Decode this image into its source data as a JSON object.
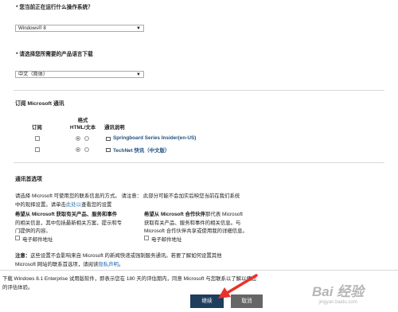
{
  "os_question": {
    "label": "* 您当前正在运行什么操作系统？",
    "value": "Windows® 8"
  },
  "lang_question": {
    "label": "* 请选择您所需要的产品语言下载",
    "value": "中文（简体）"
  },
  "subscribe": {
    "title": "订阅 Microsoft 通讯",
    "col_subscribe": "订阅",
    "col_format_line1": "格式",
    "col_format_line2": "HTML/文本",
    "col_desc": "通讯说明",
    "rows": [
      {
        "name": "Springboard Series Insider(en-US)"
      },
      {
        "name": "TechNet 快讯（中文版）"
      }
    ]
  },
  "prefs": {
    "title": "通讯首选项",
    "intro_line1": "请选择 Microsoft 可使用您的联系信息的方式。 请注意： 此部分可能不会加实后映您当前在我们系统",
    "intro_line2_a": "中的现",
    "intro_line2_b": "择设置。请单击",
    "intro_line2_link": "此处以",
    "intro_line2_c": "查看您的设置",
    "ms_head": "希望从 Microsoft 获取有关产品、服务和事件",
    "ms_line2": "的相关信息，其中包括最新相关方案，提示和专",
    "ms_line3": "门提供的内容。",
    "ms_email": "电子邮件地址",
    "partner_head_b": "希望从 Microsoft 合作伙伴",
    "partner_head_rest": "那代表 Microsoft",
    "partner_line2": "获取有关产品、服务和事件的相关信息。与",
    "partner_line3": "Microsoft 合作伙伴共享或使用我的详细信息。",
    "partner_email": "电子邮件地址"
  },
  "note": {
    "label": "注意：",
    "line1": "这些设置不会影响来自 Microsoft 的新闻快递或强制服务通讯。若要了解如何设置其他",
    "line2_a": "Microsoft 网站的联系首选项，请阅读",
    "line2_link": "隐私声明",
    "line2_b": "。"
  },
  "agreement": {
    "line1": "下载 Windows 8.1 Enterprise 试用版软件，即表示您在 180 天的评估期内，同意 Microsoft 与您联系以了解以便您",
    "line2": "的评估体验。"
  },
  "buttons": {
    "continue": "继续",
    "cancel": "取消"
  },
  "watermark": {
    "text": "Bai 经验",
    "sub": "jingyan.baidu.com"
  },
  "colors": {
    "continue_bg": "#1f3d5c",
    "cancel_bg": "#666666",
    "link": "#2a6fb3",
    "arrow": "#e8332a"
  }
}
